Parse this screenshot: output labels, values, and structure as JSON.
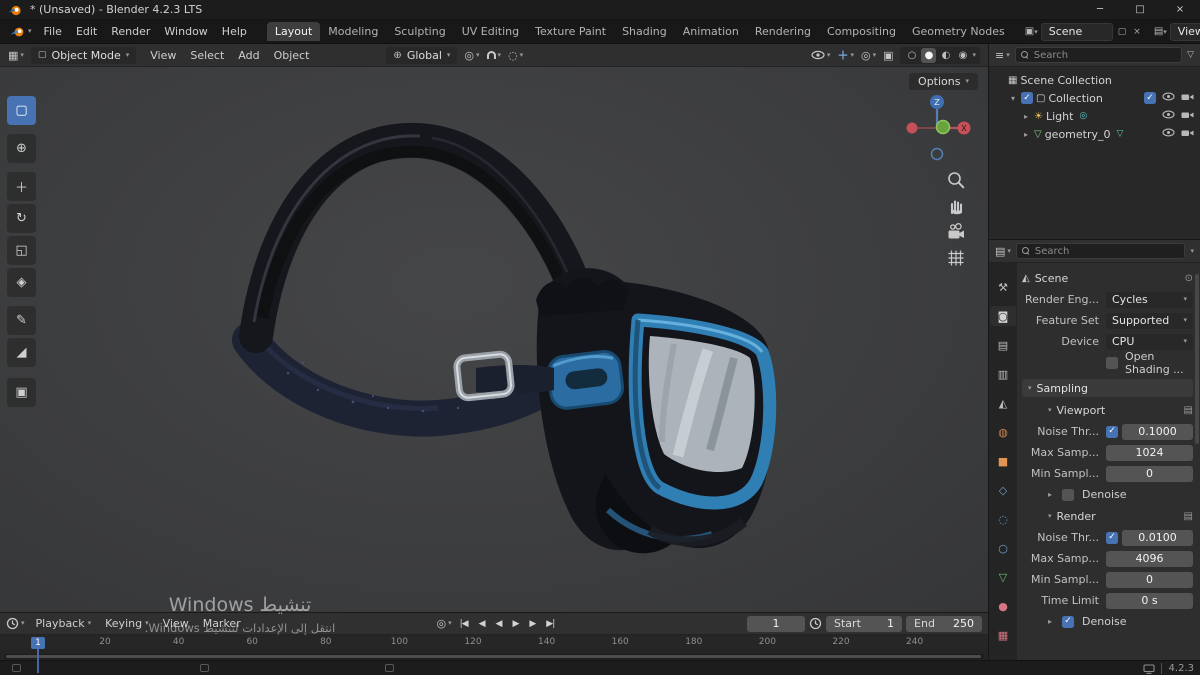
{
  "icons": {
    "minimize": "─",
    "maximize": "□",
    "close": "×",
    "check": "✓",
    "select_box": "▢",
    "cursor": "⊕",
    "move": "＋",
    "rotate": "↻",
    "scale": "◱",
    "transform": "◈",
    "annotate": "✎",
    "measure": "◢",
    "add_cube": "▣"
  },
  "titlebar": {
    "title": "* (Unsaved) - Blender 4.2.3 LTS"
  },
  "topbar": {
    "menus": [
      "File",
      "Edit",
      "Render",
      "Window",
      "Help"
    ],
    "workspaces": [
      "Layout",
      "Modeling",
      "Sculpting",
      "UV Editing",
      "Texture Paint",
      "Shading",
      "Animation",
      "Rendering",
      "Compositing",
      "Geometry Nodes"
    ],
    "active_workspace": "Layout",
    "scene_label": "Scene",
    "viewlayer_label": "ViewLayer"
  },
  "viewport": {
    "mode": "Object Mode",
    "menus": [
      "View",
      "Select",
      "Add",
      "Object"
    ],
    "orientation": "Global",
    "options_label": "Options",
    "gizmo_axes": {
      "x": "X",
      "z": "Z"
    },
    "tools": [
      {
        "name": "select-box-tool",
        "icon": "select_box",
        "active": true
      },
      {
        "name": "cursor-tool",
        "icon": "cursor"
      },
      {
        "name": "move-tool",
        "icon": "move"
      },
      {
        "name": "rotate-tool",
        "icon": "rotate"
      },
      {
        "name": "scale-tool",
        "icon": "scale"
      },
      {
        "name": "transform-tool",
        "icon": "transform"
      },
      {
        "name": "annotate-tool",
        "icon": "annotate"
      },
      {
        "name": "measure-tool",
        "icon": "measure"
      },
      {
        "name": "add-cube-tool",
        "icon": "add_cube"
      }
    ]
  },
  "outliner": {
    "search_placeholder": "Search",
    "items": [
      {
        "label": "Scene Collection",
        "icon": "▦",
        "icon_color": "#c9c9c9",
        "depth": 0,
        "expander": "",
        "checkbox": null,
        "right_checkbox": false,
        "vis": false,
        "extra": "",
        "extra_color": ""
      },
      {
        "label": "Collection",
        "icon": "▢",
        "icon_color": "#d8d8d8",
        "depth": 1,
        "expander": "▾",
        "checkbox": true,
        "right_checkbox": true,
        "vis": true,
        "extra": "",
        "extra_color": ""
      },
      {
        "label": "Light",
        "icon": "☀",
        "icon_color": "#e3c05c",
        "depth": 2,
        "expander": "▸",
        "checkbox": null,
        "right_checkbox": false,
        "vis": true,
        "extra": "◎",
        "extra_color": "#5fc9c4"
      },
      {
        "label": "geometry_0",
        "icon": "▽",
        "icon_color": "#7ec97e",
        "depth": 2,
        "expander": "▸",
        "checkbox": null,
        "right_checkbox": false,
        "vis": true,
        "extra": "▽",
        "extra_color": "#57c9a0"
      }
    ]
  },
  "properties": {
    "search_placeholder": "Search",
    "breadcrumb": "Scene",
    "tabs": [
      {
        "name": "tool-tab",
        "glyph": "⚒",
        "color": "#bcbcbc"
      },
      {
        "name": "render-tab",
        "glyph": "◙",
        "color": "#d2d2d2",
        "active": true
      },
      {
        "name": "output-tab",
        "glyph": "▤",
        "color": "#bcbcbc"
      },
      {
        "name": "view-layer-tab",
        "glyph": "▥",
        "color": "#bcbcbc"
      },
      {
        "name": "scene-tab",
        "glyph": "◭",
        "color": "#bcbcbc"
      },
      {
        "name": "world-tab",
        "glyph": "◍",
        "color": "#cc8455"
      },
      {
        "name": "object-tab",
        "glyph": "■",
        "color": "#e09553"
      },
      {
        "name": "modifiers-tab",
        "glyph": "◇",
        "color": "#6e9fd0"
      },
      {
        "name": "physics-tab",
        "glyph": "◌",
        "color": "#6e9fd0"
      },
      {
        "name": "constraints-tab",
        "glyph": "○",
        "color": "#6e9fd0"
      },
      {
        "name": "object-data-tab",
        "glyph": "▽",
        "color": "#6fbf6f"
      },
      {
        "name": "material-tab",
        "glyph": "●",
        "color": "#d77583"
      },
      {
        "name": "texture-tab",
        "glyph": "▦",
        "color": "#d77583"
      }
    ],
    "render_engine": {
      "label": "Render Eng...",
      "value": "Cycles"
    },
    "feature_set": {
      "label": "Feature Set",
      "value": "Supported"
    },
    "device": {
      "label": "Device",
      "value": "CPU"
    },
    "open_shading": {
      "label": "Open Shading ..."
    },
    "sampling": {
      "title": "Sampling",
      "viewport": {
        "title": "Viewport",
        "noise_label": "Noise Thr...",
        "noise_value": "0.1000",
        "max_label": "Max Samp...",
        "max_value": "1024",
        "min_label": "Min Sampl...",
        "min_value": "0",
        "denoise_label": "Denoise"
      },
      "render": {
        "title": "Render",
        "noise_label": "Noise Thr...",
        "noise_value": "0.0100",
        "max_label": "Max Samp...",
        "max_value": "4096",
        "min_label": "Min Sampl...",
        "min_value": "0",
        "time_label": "Time Limit",
        "time_value": "0 s",
        "denoise_label": "Denoise"
      }
    }
  },
  "timeline": {
    "menus": [
      "Playback",
      "Keying",
      "View",
      "Marker"
    ],
    "controls": [
      {
        "name": "jump-start-button",
        "glyph": "|◀"
      },
      {
        "name": "prev-keyframe-button",
        "glyph": "◀"
      },
      {
        "name": "play-reverse-button",
        "glyph": "◀"
      },
      {
        "name": "play-button",
        "glyph": "▶"
      },
      {
        "name": "next-keyframe-button",
        "glyph": "▶"
      },
      {
        "name": "jump-end-button",
        "glyph": "▶|"
      }
    ],
    "frame_current": "1",
    "start_label": "Start",
    "start_value": "1",
    "end_label": "End",
    "end_value": "250",
    "ticks": [
      "20",
      "40",
      "60",
      "80",
      "100",
      "120",
      "140",
      "160",
      "180",
      "200",
      "220",
      "240"
    ],
    "playhead_label": "1"
  },
  "watermark": {
    "line1": "تنشيط Windows",
    "line2": "انتقل إلى الإعدادات لتنشيط Windows."
  },
  "statusbar": {
    "version": "4.2.3"
  }
}
